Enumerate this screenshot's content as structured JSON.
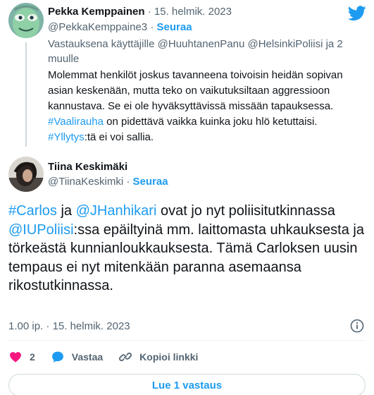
{
  "parent": {
    "name": "Pekka Kemppainen",
    "separator": "·",
    "date": "15. helmik. 2023",
    "handle": "@PekkaKemppaine3",
    "follow_label": "Seuraa",
    "reply_prefix": "Vastauksena käyttäjille",
    "reply_mentions": [
      "@HuuhtanenPanu",
      "@HelsinkiPoliisi"
    ],
    "reply_suffix": "ja 2 muulle",
    "text_part1": "Molemmat henkilöt joskus tavanneena toivoisin heidän sopivan asian keskenään, mutta teko on vaikutuksiltaan aggressioon kannustava. Se ei ole hyväksyttävissä missään tapauksessa.",
    "hashtag1": "#Vaalirauha",
    "text_part2": "on pidettävä vaikka kuinka joku hlö ketuttaisi.",
    "hashtag2": "#Yllytys",
    "text_part3": ":tä ei voi sallia."
  },
  "main": {
    "name": "Tiina Keskimäki",
    "handle": "@TiinaKeskimki",
    "separator": "·",
    "follow_label": "Seuraa",
    "t1": "#Carlos",
    "t2": " ja ",
    "t3": "@JHanhikari",
    "t4": " ovat jo nyt poliisitutkinnassa ",
    "t5": "@IUPoliisi",
    "t6": ":ssa epäiltyinä mm. laittomasta uhkauksesta ja törkeästä kunnianloukkauksesta. Tämä Carloksen uusin tempaus ei nyt mitenkään paranna asemaansa rikostutkinnassa.",
    "time": "1.00 ip.",
    "date": "15. helmik. 2023"
  },
  "actions": {
    "like_count": "2",
    "reply_label": "Vastaa",
    "copy_label": "Kopioi linkki"
  },
  "read_replies_label": "Lue 1 vastaus",
  "icons": {
    "brand": "twitter-bird-icon",
    "like": "heart-icon",
    "reply": "reply-bubble-icon",
    "copy": "link-icon",
    "info": "info-icon"
  },
  "colors": {
    "accent": "#1d9bf0",
    "like": "#f91880",
    "secondary_text": "#536471"
  }
}
